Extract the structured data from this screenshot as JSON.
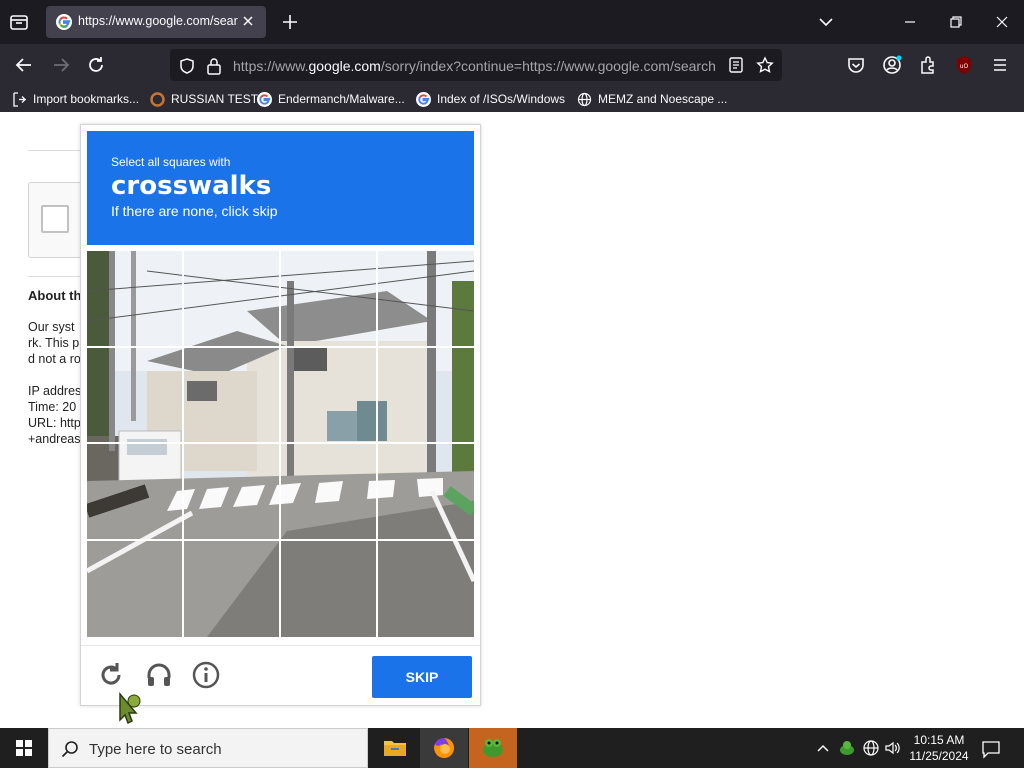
{
  "browser": {
    "tab_title": "https://www.google.com/searc",
    "url_prefix": "https://www.",
    "url_host": "google.com",
    "url_rest": "/sorry/index?continue=https://www.google.com/search"
  },
  "bookmarks": [
    {
      "label": "Import bookmarks..."
    },
    {
      "label": "RUSSIAN TEST"
    },
    {
      "label": "Endermanch/Malware..."
    },
    {
      "label": "Index of /ISOs/Windows"
    },
    {
      "label": "MEMZ and Noescape ..."
    }
  ],
  "page": {
    "about_heading": "About th",
    "about_lines": [
      "Our syst",
      "rk. This p",
      "d not a ro"
    ],
    "info_lines": [
      "IP addres",
      "Time: 20",
      "URL: http",
      "+andreas"
    ]
  },
  "captcha": {
    "instruction_small": "Select all squares with",
    "instruction_target": "crosswalks",
    "instruction_sub": "If there are none, click skip",
    "skip_label": "SKIP"
  },
  "taskbar": {
    "search_placeholder": "Type here to search",
    "time": "10:15 AM",
    "date": "11/25/2024"
  },
  "colors": {
    "captcha_blue": "#1a73e8",
    "browser_dark": "#1c1b22",
    "toolbar": "#2b2a33"
  }
}
